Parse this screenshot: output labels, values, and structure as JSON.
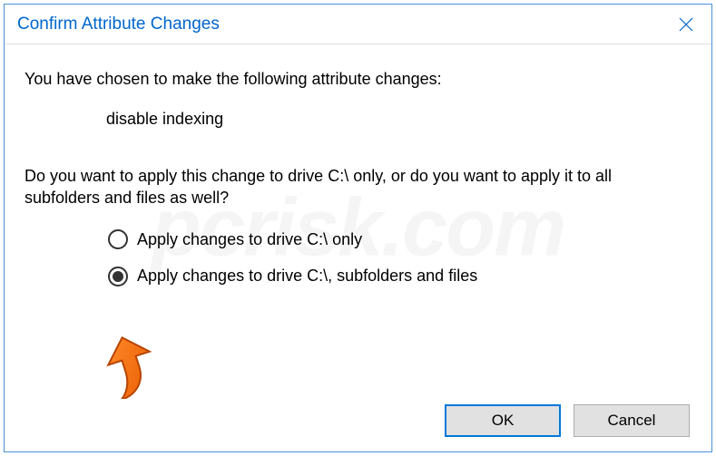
{
  "dialog": {
    "title": "Confirm Attribute Changes",
    "intro": "You have chosen to make the following attribute changes:",
    "change_item": "disable indexing",
    "question": "Do you want to apply this change to drive C:\\ only, or do you want to apply it to all subfolders and files as well?",
    "options": [
      {
        "label": "Apply changes to drive C:\\ only",
        "selected": false
      },
      {
        "label": "Apply changes to drive C:\\, subfolders and files",
        "selected": true
      }
    ],
    "buttons": {
      "ok": "OK",
      "cancel": "Cancel"
    }
  },
  "watermark": "pcrisk.com"
}
